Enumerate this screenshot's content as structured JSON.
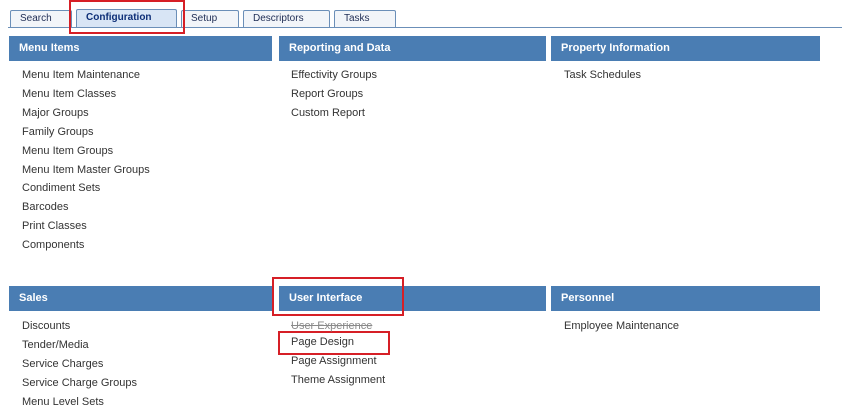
{
  "tabs": [
    {
      "label": "Search"
    },
    {
      "label": "Configuration"
    },
    {
      "label": "Setup"
    },
    {
      "label": "Descriptors"
    },
    {
      "label": "Tasks"
    }
  ],
  "sections": {
    "menu_items": {
      "title": "Menu Items",
      "items": [
        "Menu Item Maintenance",
        "Menu Item Classes",
        "Major Groups",
        "Family Groups",
        "Menu Item Groups",
        "Menu Item Master Groups",
        "Condiment Sets",
        "Barcodes",
        "Print Classes",
        "Components"
      ]
    },
    "reporting": {
      "title": "Reporting and Data",
      "items": [
        "Effectivity Groups",
        "Report Groups",
        "Custom Report"
      ]
    },
    "property": {
      "title": "Property Information",
      "items": [
        "Task Schedules"
      ]
    },
    "sales": {
      "title": "Sales",
      "items": [
        "Discounts",
        "Tender/Media",
        "Service Charges",
        "Service Charge Groups",
        "Menu Level Sets"
      ]
    },
    "user_interface": {
      "title": "User Interface",
      "items": [
        "User Experience",
        "Page Design",
        "Page Assignment",
        "Theme Assignment"
      ]
    },
    "personnel": {
      "title": "Personnel",
      "items": [
        "Employee Maintenance"
      ]
    }
  }
}
